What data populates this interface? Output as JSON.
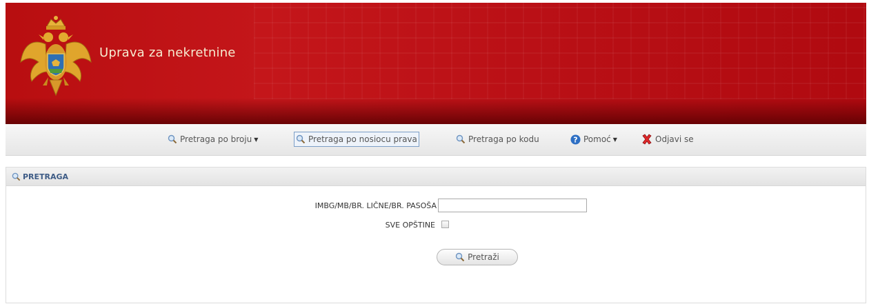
{
  "header": {
    "site_title": "Uprava za nekretnine",
    "emblem_icon": "montenegro-coat-of-arms-icon",
    "brand_color": "#c4161a"
  },
  "nav": {
    "items": [
      {
        "label": "Pretraga po broju",
        "icon": "magnifier-icon",
        "has_dropdown": true,
        "active": false
      },
      {
        "label": "Pretraga po nosiocu prava",
        "icon": "magnifier-icon",
        "has_dropdown": false,
        "active": true
      },
      {
        "label": "Pretraga po kodu",
        "icon": "magnifier-icon",
        "has_dropdown": false,
        "active": false
      },
      {
        "label": "Pomoć",
        "icon": "help-icon",
        "has_dropdown": true,
        "active": false
      },
      {
        "label": "Odjavi se",
        "icon": "logout-icon",
        "has_dropdown": false,
        "active": false
      }
    ]
  },
  "panel": {
    "title": "PRETRAGA",
    "id_label": "IMBG/MB/BR. LIČNE/BR. PASOŠA",
    "id_value": "",
    "all_municipalities_label": "SVE OPŠTINE",
    "all_municipalities_checked": false,
    "search_button": "Pretraži"
  }
}
